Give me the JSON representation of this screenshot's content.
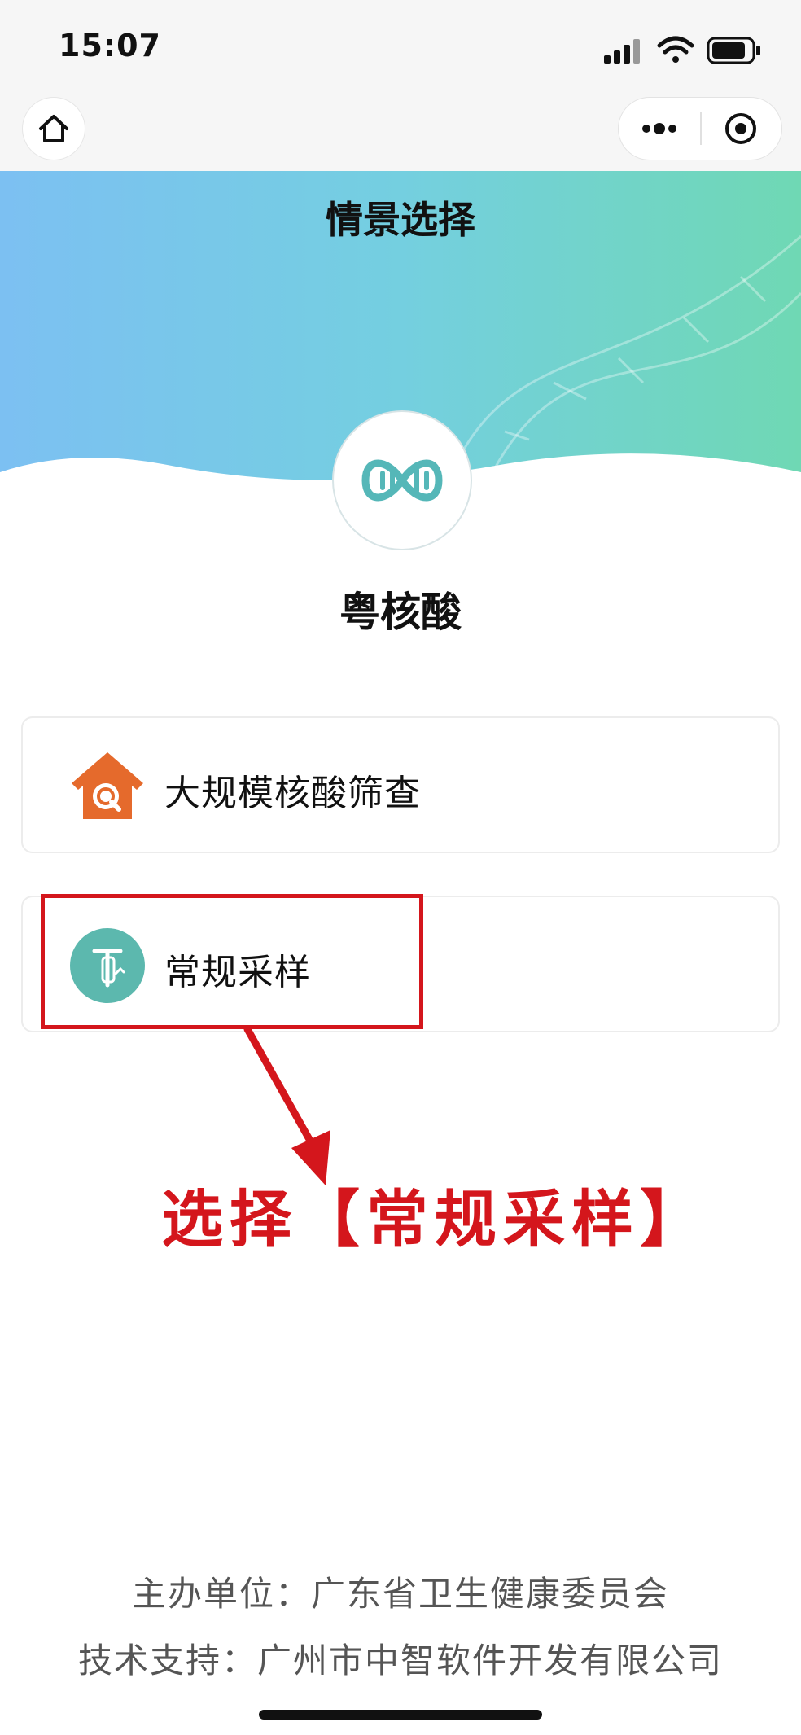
{
  "status_bar": {
    "time": "15:07",
    "icons": [
      "signal-icon",
      "wifi-icon",
      "battery-icon"
    ]
  },
  "nav_bar": {
    "icons": [
      "home-icon",
      "more-icon",
      "close-capsule-icon"
    ]
  },
  "header": {
    "title": "情景选择",
    "app_name": "粤核酸"
  },
  "options": [
    {
      "label": "大规模核酸筛查",
      "icon": "house-search-icon",
      "color": "#e56a2c"
    },
    {
      "label": "常规采样",
      "icon": "swab-tube-icon",
      "color": "#5cb8ae"
    }
  ],
  "annotation": {
    "text": "选择【常规采样】",
    "color": "#d4161c"
  },
  "footer": {
    "organizer": "主办单位：广东省卫生健康委员会",
    "support": "技术支持：广州市中智软件开发有限公司"
  },
  "colors": {
    "banner_left": "#7cc0f2",
    "banner_right": "#6fd8b4"
  }
}
